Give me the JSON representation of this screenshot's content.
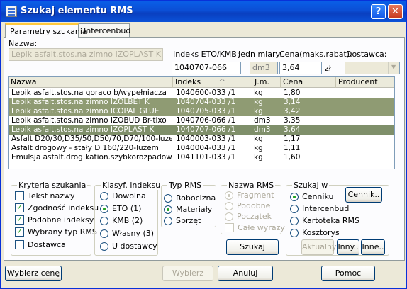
{
  "window": {
    "title": "Szukaj elementu RMS",
    "help_glyph": "?",
    "close_glyph": "✕"
  },
  "tabs": [
    {
      "label": "Parametry szukania"
    },
    {
      "label": "Intercenbud"
    }
  ],
  "search": {
    "name_label": "Nazwa:",
    "name_value": "Lepik asfalt.stos.na zimno IZOPLAST K",
    "index_label": "Indeks ETO/KMB:",
    "index_value": "1040707-066",
    "unit_label": "Jedn miary:",
    "unit_value": "dm3",
    "price_label": "Cena(maks.rabat):",
    "price_value": "3,64",
    "currency": "zł",
    "supplier_label": "Dostawca:",
    "supplier_value": ""
  },
  "table": {
    "columns": [
      "Nazwa",
      "Indeks",
      "J.m.",
      "Cena",
      "Producent"
    ],
    "sort_indicator": "^",
    "rows": [
      {
        "name": "Lepik asfalt.stos.na gorąco b/wypełniacza",
        "index": "1040600-033 /1",
        "unit": "kg",
        "price": "1,80",
        "producer": "",
        "state": "normal"
      },
      {
        "name": "Lepik asfalt.stos.na zimno IZOLBET K",
        "index": "1040704-033 /1",
        "unit": "kg",
        "price": "3,14",
        "producer": "",
        "state": "highlight"
      },
      {
        "name": "Lepik asfalt.stos.na zimno ICOPAL GLUE",
        "index": "1040705-033 /1",
        "unit": "kg",
        "price": "3,42",
        "producer": "",
        "state": "highlight"
      },
      {
        "name": "Lepik asfalt.stos.na zimno IZOBUD Br-tixo",
        "index": "1040706-066 /1",
        "unit": "dm3",
        "price": "3,35",
        "producer": "",
        "state": "normal"
      },
      {
        "name": "Lepik asfalt.stos.na zimno IZOPLAST K",
        "index": "1040707-066 /1",
        "unit": "dm3",
        "price": "3,64",
        "producer": "",
        "state": "selected"
      },
      {
        "name": "Asfalt D20/30,D35/50,D50/70,D70/100-luzem",
        "index": "1040003-033 /1",
        "unit": "kg",
        "price": "1,17",
        "producer": "",
        "state": "normal"
      },
      {
        "name": "Asfalt drogowy - stały D 160/220-luzem",
        "index": "1040004-033 /1",
        "unit": "kg",
        "price": "1,11",
        "producer": "",
        "state": "normal"
      },
      {
        "name": "Emulsja asfalt.drog.kation.szybkorozpadowa",
        "index": "1041101-033 /1",
        "unit": "kg",
        "price": "1,60",
        "producer": "",
        "state": "normal"
      }
    ]
  },
  "criteria": {
    "title": "Kryteria szukania",
    "items": [
      {
        "label": "Tekst nazwy",
        "checked": false
      },
      {
        "label": "Zgodność indeksu",
        "checked": true
      },
      {
        "label": "Podobne indeksy",
        "checked": true
      },
      {
        "label": "Wybrany typ RMS",
        "checked": true
      },
      {
        "label": "Dostawca",
        "checked": false
      }
    ]
  },
  "index_class": {
    "title": "Klasyf. indeksu",
    "items": [
      {
        "label": "Dowolna",
        "checked": false
      },
      {
        "label": "ETO (1)",
        "checked": true
      },
      {
        "label": "KMB (2)",
        "checked": false
      },
      {
        "label": "Własny (3)",
        "checked": false
      },
      {
        "label": "U dostawcy",
        "checked": false
      }
    ]
  },
  "rms_type": {
    "title": "Typ RMS",
    "items": [
      {
        "label": "Robocizna",
        "checked": false
      },
      {
        "label": "Materiały",
        "checked": true
      },
      {
        "label": "Sprzęt",
        "checked": false
      }
    ]
  },
  "rms_name": {
    "title": "Nazwa RMS",
    "items": [
      {
        "label": "Fragment",
        "checked": true
      },
      {
        "label": "Podobne",
        "checked": false
      },
      {
        "label": "Początek",
        "checked": false
      }
    ],
    "whole_words": "Całe wyrazy",
    "search_button": "Szukaj"
  },
  "search_in": {
    "title": "Szukaj w",
    "items": [
      {
        "label": "Cenniku",
        "checked": true
      },
      {
        "label": "Intercenbud",
        "checked": false
      },
      {
        "label": "Kartoteka RMS",
        "checked": false
      },
      {
        "label": "Kosztorys",
        "checked": false
      }
    ],
    "price_list_button": "Cennik..",
    "current_button": "Aktualny",
    "other_button": "Inny..",
    "others_button": "Inne.."
  },
  "footer": {
    "choose_price": "Wybierz cenę",
    "choose": "Wybierz",
    "cancel": "Anuluj",
    "help": "Pomoc"
  },
  "colors": {
    "titlebar": "#0b4fd6",
    "selected_row": "#7f8f6a",
    "highlight_row": "#8f9b73",
    "dialog_bg": "#ece9d8"
  }
}
